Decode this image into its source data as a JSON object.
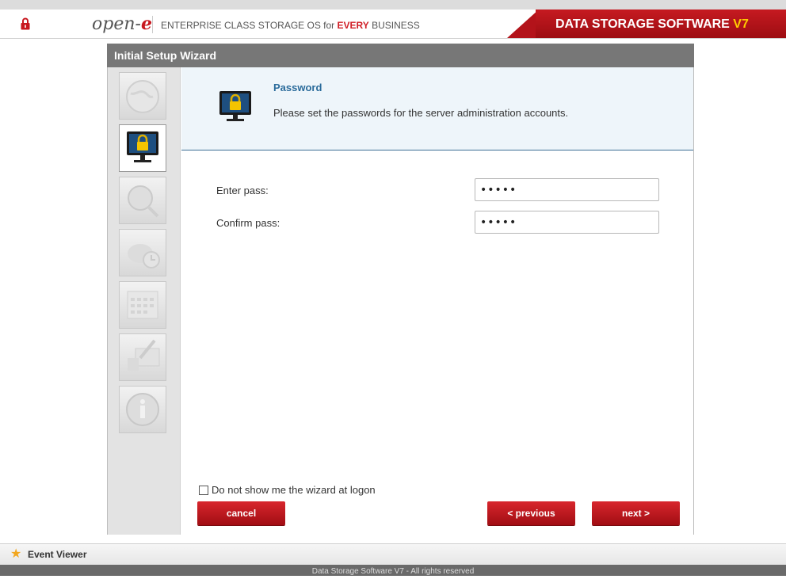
{
  "header": {
    "logo_text": "open-",
    "logo_e": "e",
    "tagline_prefix": "ENTERPRISE CLASS STORAGE OS for ",
    "tagline_every": "EVERY",
    "tagline_suffix": " BUSINESS",
    "brand_main": "DATA STORAGE SOFTWARE ",
    "brand_version": "V7"
  },
  "wizard": {
    "title": "Initial Setup Wizard",
    "steps": [
      {
        "icon": "globe-icon",
        "active": false
      },
      {
        "icon": "monitor-lock-icon",
        "active": true
      },
      {
        "icon": "network-search-icon",
        "active": false
      },
      {
        "icon": "clock-icon",
        "active": false
      },
      {
        "icon": "calendar-icon",
        "active": false
      },
      {
        "icon": "monitor-pencil-icon",
        "active": false
      },
      {
        "icon": "info-icon",
        "active": false
      }
    ],
    "step_title": "Password",
    "step_description": "Please set the passwords for the server administration accounts.",
    "fields": [
      {
        "label": "Enter pass:",
        "value": "•••••"
      },
      {
        "label": "Confirm pass:",
        "value": "•••••"
      }
    ],
    "no_show_label": "Do not show me the wizard at logon",
    "buttons": {
      "cancel": "cancel",
      "previous": "< previous",
      "next": "next >"
    }
  },
  "event_viewer": {
    "label": "Event Viewer"
  },
  "footer": {
    "text": "Data Storage Software V7 - All rights reserved"
  },
  "colors": {
    "accent_red": "#c61a21",
    "header_blue": "#2a6b9b",
    "title_bar": "#777777"
  }
}
